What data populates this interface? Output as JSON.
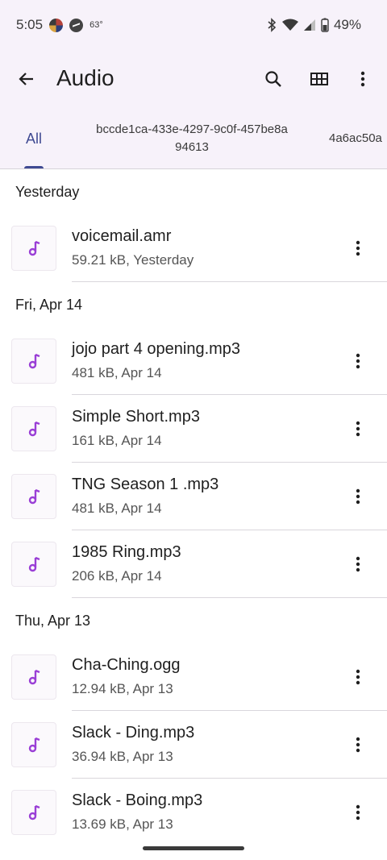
{
  "status_bar": {
    "time": "5:05",
    "temperature": "63°",
    "battery": "49%"
  },
  "app_bar": {
    "title": "Audio",
    "back_icon": "arrow-back-icon",
    "search_icon": "search-icon",
    "grid_icon": "grid-view-icon",
    "more_icon": "more-vert-icon"
  },
  "tabs": [
    {
      "label": "All"
    },
    {
      "label": "bccde1ca-433e-4297-9c0f-457be8a",
      "label2": "94613"
    },
    {
      "label": "4a6ac50a"
    }
  ],
  "sections": [
    {
      "header": "Yesterday",
      "files": [
        {
          "name": "voicemail.amr",
          "meta": "59.21 kB, Yesterday"
        }
      ]
    },
    {
      "header": "Fri, Apr 14",
      "files": [
        {
          "name": "jojo part 4 opening.mp3",
          "meta": "481 kB, Apr 14"
        },
        {
          "name": "Simple Short.mp3",
          "meta": "161 kB, Apr 14"
        },
        {
          "name": "TNG Season 1 .mp3",
          "meta": "481 kB, Apr 14"
        },
        {
          "name": "1985 Ring.mp3",
          "meta": "206 kB, Apr 14"
        }
      ]
    },
    {
      "header": "Thu, Apr 13",
      "files": [
        {
          "name": "Cha-Ching.ogg",
          "meta": "12.94 kB, Apr 13"
        },
        {
          "name": "Slack - Ding.mp3",
          "meta": "36.94 kB, Apr 13"
        },
        {
          "name": "Slack - Boing.mp3",
          "meta": "13.69 kB, Apr 13"
        }
      ]
    }
  ],
  "colors": {
    "accent": "#3f4a92",
    "music_icon": "#9a3fd6",
    "header_bg": "#f7f2fa"
  }
}
